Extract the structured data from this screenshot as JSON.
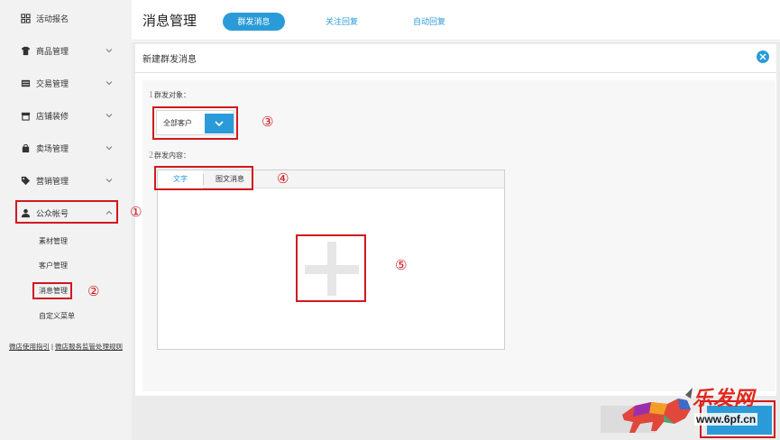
{
  "sidebar": {
    "items": [
      {
        "label": "活动报名",
        "icon": "grid-icon",
        "expandable": false
      },
      {
        "label": "商品管理",
        "icon": "tshirt-icon",
        "expandable": true
      },
      {
        "label": "交易管理",
        "icon": "list-icon",
        "expandable": true
      },
      {
        "label": "店铺装修",
        "icon": "store-icon",
        "expandable": true
      },
      {
        "label": "卖场管理",
        "icon": "bag-icon",
        "expandable": true
      },
      {
        "label": "营销管理",
        "icon": "tag-icon",
        "expandable": true
      },
      {
        "label": "公众帐号",
        "icon": "user-icon",
        "expandable": true,
        "expanded": true
      }
    ],
    "sub_items": [
      "素材管理",
      "客户管理",
      "消息管理",
      "自定义菜单"
    ],
    "selected_sub_item": "消息管理",
    "footer_links": [
      "微店使用指引",
      "微店服务监管处理规则"
    ]
  },
  "header": {
    "title": "消息管理",
    "tabs": [
      {
        "label": "群发消息",
        "active": true
      },
      {
        "label": "关注回复",
        "active": false
      },
      {
        "label": "自动回复",
        "active": false
      }
    ]
  },
  "card": {
    "title": "新建群发消息",
    "step1": {
      "num": "1",
      "label": "群发对象："
    },
    "target_select": {
      "value": "全部客户"
    },
    "step2": {
      "num": "2",
      "label": "群发内容："
    },
    "editor_tabs": [
      {
        "label": "文字",
        "active": true
      },
      {
        "label": "图文消息",
        "active": false
      }
    ]
  },
  "annotations": [
    "①",
    "②",
    "③",
    "④",
    "⑤"
  ],
  "watermark": {
    "text": "乐发网",
    "url": "www.6pf.cn"
  },
  "colors": {
    "accent": "#2a9bd8",
    "annotation_red": "#d0191f",
    "sidebar_bg": "#f2f2f2",
    "content_bg": "#ebebeb"
  }
}
